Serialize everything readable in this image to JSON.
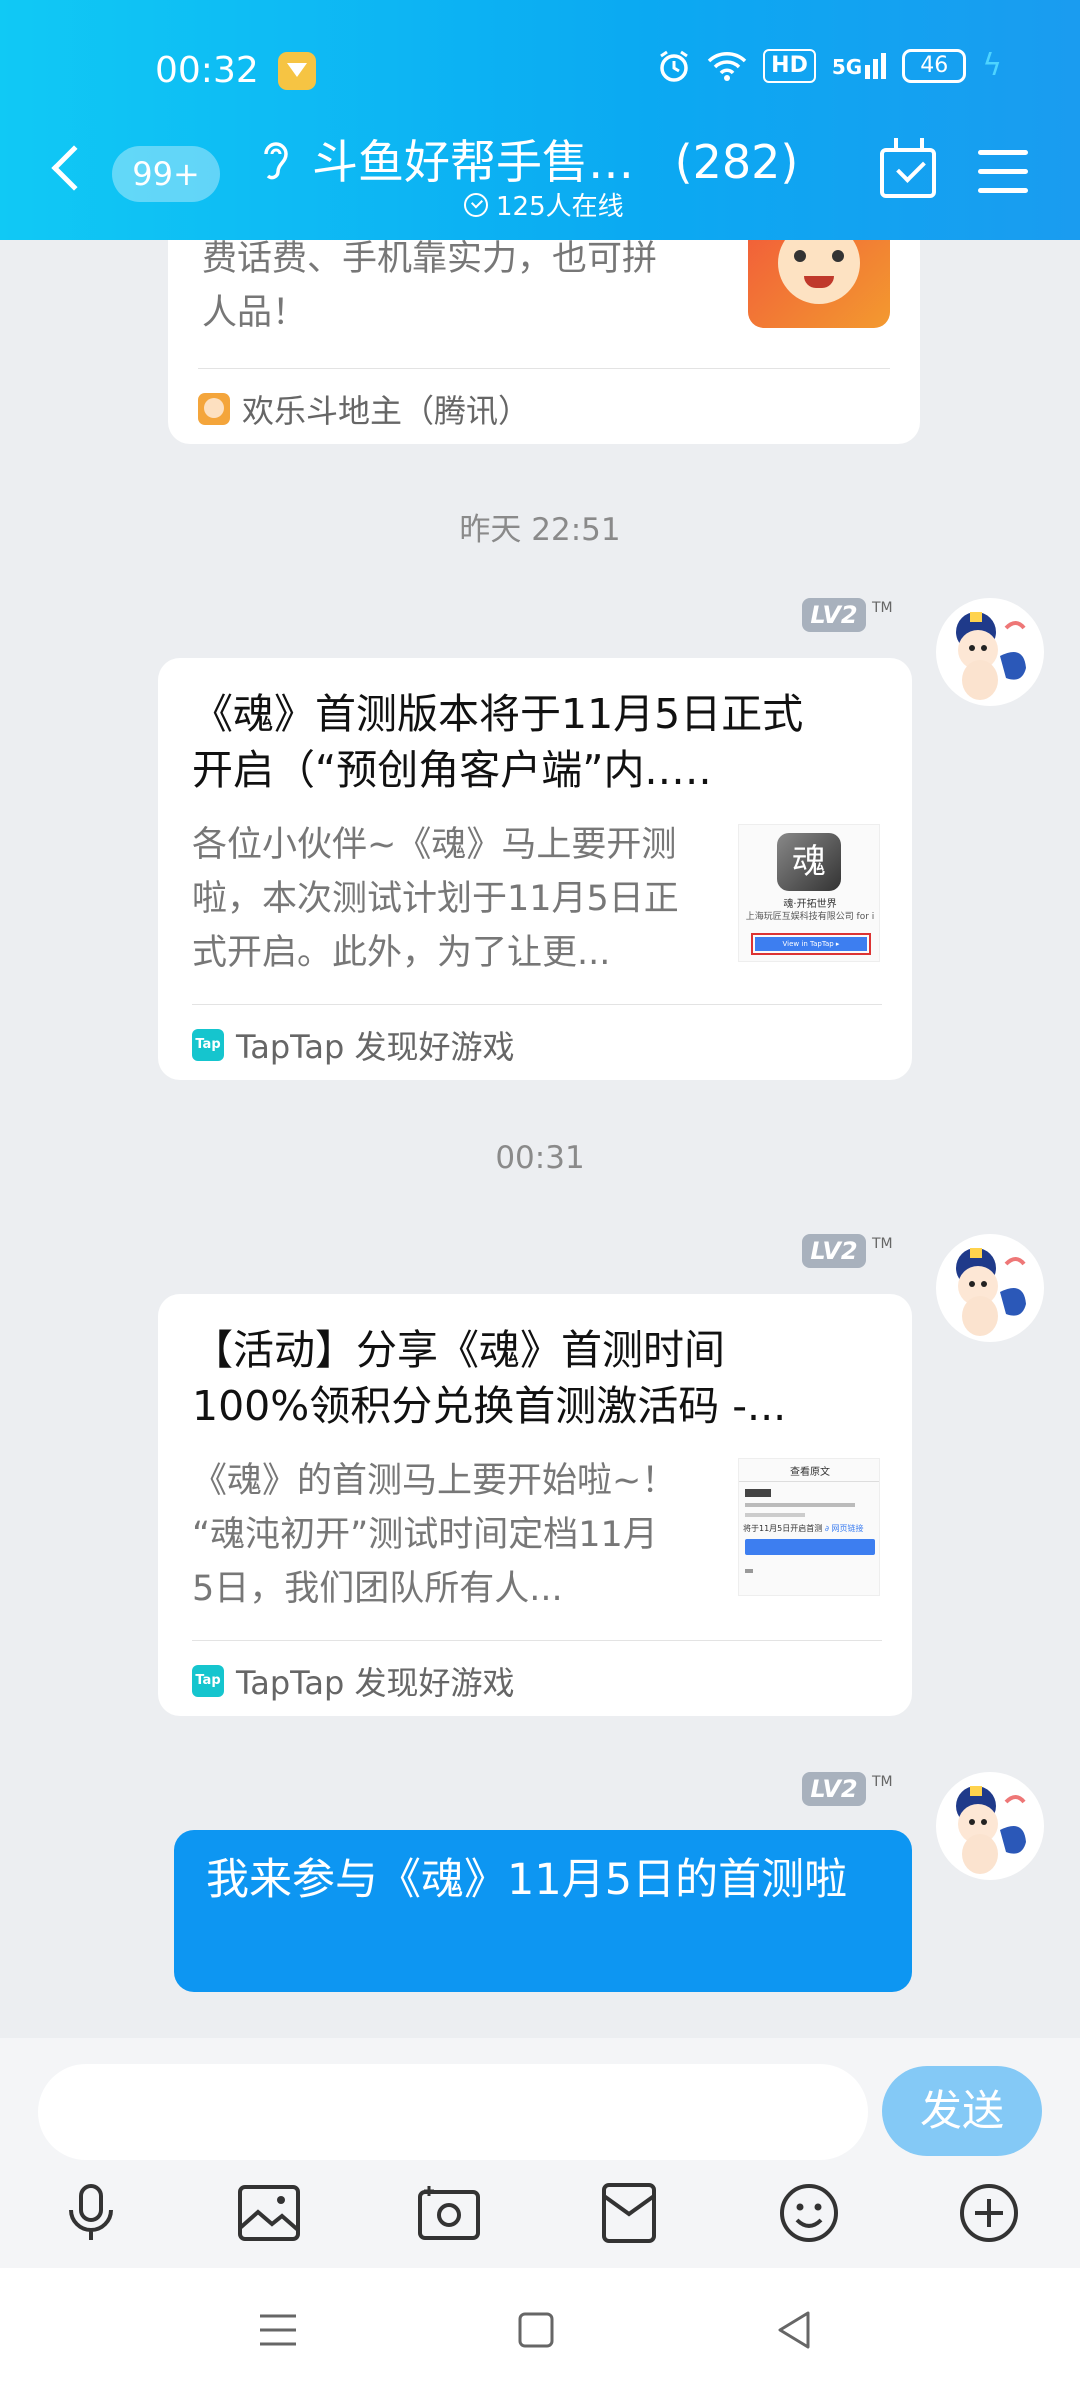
{
  "status_bar": {
    "time": "00:32",
    "hd": "HD",
    "network": "5G",
    "battery": "46"
  },
  "header": {
    "unread_badge": "99+",
    "title": "斗鱼好帮手售…",
    "member_count": "(282)",
    "online": "125人在线"
  },
  "messages": {
    "card0": {
      "desc_line1": "费话费、手机靠实力，也可拼",
      "desc_line2": "人品！",
      "source": "欢乐斗地主（腾讯）"
    },
    "ts1": "昨天 22:51",
    "card1": {
      "title_line1": "《魂》首测版本将于11月5日正式",
      "title_line2": "开启（“预创角客户端”内.….",
      "desc_line1": "各位小伙伴~《魂》马上要开测",
      "desc_line2": "啦，本次测试计划于11月5日正",
      "desc_line3": "式开启。此外，为了让更...",
      "source": "TapTap 发现好游戏",
      "thumb_line1": "魂·开拓世界",
      "thumb_line2": "上海玩匠互娱科技有限公司 for i",
      "thumb_btn": "View in TapTap ▸"
    },
    "ts2": "00:31",
    "card2": {
      "title_line1": "【活动】分享《魂》首测时间",
      "title_line2": "100%领积分兑换首测激活码 -...",
      "desc_line1": "《魂》的首测马上要开始啦~！",
      "desc_line2": "“魂沌初开”测试时间定档11月",
      "desc_line3": "5日，我们团队所有人...",
      "source": "TapTap 发现好游戏",
      "thumb_header": "查看原文",
      "thumb_body": "将于11月5日开启首测",
      "thumb_link": "∂ 网页链接"
    },
    "level_badge": "LV2",
    "tm": "TM",
    "my_message": "我来参与《魂》11月5日的首测啦"
  },
  "input": {
    "placeholder": "",
    "send_label": "发送"
  },
  "colors": {
    "header": "#0ba9f2",
    "bubble": "#0d96f2",
    "send": "#84c9f6",
    "taptap": "#15c5ce"
  }
}
